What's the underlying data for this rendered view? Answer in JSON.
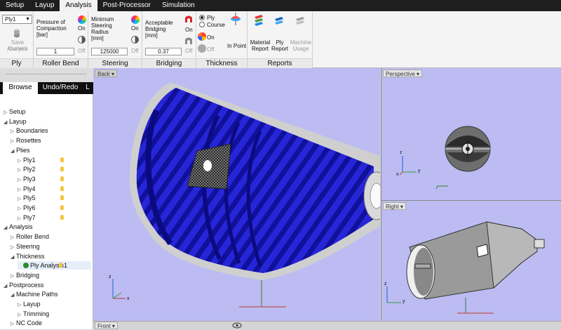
{
  "menu": {
    "tabs": [
      "Setup",
      "Layup",
      "Analysis",
      "Post-Processor",
      "Simulation"
    ],
    "active": "Analysis"
  },
  "ribbon": {
    "ply": {
      "select_value": "Ply1",
      "save_line1": "Save Current",
      "save_line2": "Analysis",
      "title": "Ply"
    },
    "roller_bend": {
      "label_line1": "Pressure of",
      "label_line2": "Compaction",
      "label_line3": "[bar]",
      "value": "1",
      "on": "On",
      "off": "Off",
      "title": "Roller Bend"
    },
    "steering": {
      "label_line1": "Minimum",
      "label_line2": "Steering",
      "label_line3": "Radius",
      "label_line4": "[mm]",
      "value": "125000",
      "on": "On",
      "off": "Off",
      "title": "Steering"
    },
    "bridging": {
      "label_line1": "Acceptable",
      "label_line2": "Bridging",
      "label_line3": "[mm]",
      "value": "0.37",
      "on": "On",
      "off": "Off",
      "title": "Bridging"
    },
    "thickness": {
      "ply": "Ply",
      "course": "Course",
      "on": "On",
      "off": "Off",
      "in_point": "In Point",
      "title": "Thickness"
    },
    "reports": {
      "material_line1": "Material",
      "material_line2": "Report",
      "ply_line1": "Ply",
      "ply_line2": "Report",
      "machine_line1": "Machine",
      "machine_line2": "Usage",
      "title": "Reports"
    }
  },
  "panel": {
    "tabs": [
      "Browse",
      "Undo/Redo",
      "L"
    ],
    "tree": [
      {
        "label": "Setup",
        "level": 0,
        "exp": "▷"
      },
      {
        "label": "Layup",
        "level": 0,
        "exp": "◢"
      },
      {
        "label": "Boundaries",
        "level": 1,
        "exp": "▷"
      },
      {
        "label": "Rosettes",
        "level": 1,
        "exp": "▷"
      },
      {
        "label": "Plies",
        "level": 1,
        "exp": "◢"
      },
      {
        "label": "Ply1",
        "level": 2,
        "exp": "▷",
        "bulb": true
      },
      {
        "label": "Ply2",
        "level": 2,
        "exp": "▷",
        "bulb": true
      },
      {
        "label": "Ply3",
        "level": 2,
        "exp": "▷",
        "bulb": true
      },
      {
        "label": "Ply4",
        "level": 2,
        "exp": "▷",
        "bulb": true
      },
      {
        "label": "Ply5",
        "level": 2,
        "exp": "▷",
        "bulb": true
      },
      {
        "label": "Ply6",
        "level": 2,
        "exp": "▷",
        "bulb": true
      },
      {
        "label": "Ply7",
        "level": 2,
        "exp": "▷",
        "bulb": true
      },
      {
        "label": "Analysis",
        "level": 0,
        "exp": "◢"
      },
      {
        "label": "Roller Bend",
        "level": 1,
        "exp": "▷"
      },
      {
        "label": "Steering",
        "level": 1,
        "exp": "▷"
      },
      {
        "label": "Thickness",
        "level": 1,
        "exp": "◢"
      },
      {
        "label": "Ply Analysis1",
        "level": 2,
        "exp": "",
        "check": true,
        "bulb": true,
        "selected": true
      },
      {
        "label": "Bridging",
        "level": 1,
        "exp": "▷"
      },
      {
        "label": "Postprocess",
        "level": 0,
        "exp": "◢"
      },
      {
        "label": "Machine Paths",
        "level": 1,
        "exp": "◢"
      },
      {
        "label": "Layup",
        "level": 2,
        "exp": "▷"
      },
      {
        "label": "Trimming",
        "level": 2,
        "exp": "▷"
      },
      {
        "label": "NC Code",
        "level": 1,
        "exp": "▷"
      }
    ]
  },
  "viewports": {
    "back": "Back",
    "perspective": "Perspective",
    "right": "Right",
    "front": "Front"
  },
  "axes": {
    "x": "x",
    "y": "y",
    "z": "z"
  },
  "icons": {
    "save": "floppy-icon",
    "wheel": "color-wheel-icon",
    "half": "half-disc-icon"
  }
}
